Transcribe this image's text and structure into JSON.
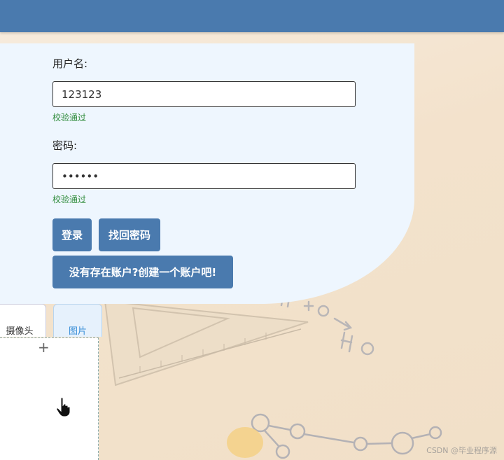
{
  "login": {
    "username_label": "用户名:",
    "username_value": "123123",
    "username_status": "校验通过",
    "password_label": "密码:",
    "password_value": "123123",
    "password_status": "校验通过",
    "login_button": "登录",
    "recover_button": "找回密码",
    "register_button": "没有存在账户?创建一个账户吧!"
  },
  "upload": {
    "tab_camera": "摄像头",
    "tab_image": "图片",
    "add_icon": "plus-icon"
  },
  "watermark": "CSDN @毕业程序源",
  "colors": {
    "header": "#4a7aae",
    "button": "#4a7aae",
    "panel": "#eef6fe",
    "valid": "#2e8b3a",
    "tab_active_text": "#3a8fd8"
  }
}
